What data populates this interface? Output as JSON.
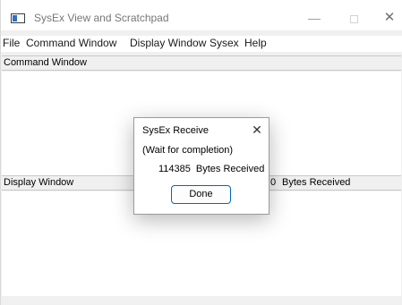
{
  "app": {
    "title": "SysEx View and Scratchpad",
    "window_controls": {
      "minimize": "—",
      "maximize": "",
      "close": "✕"
    }
  },
  "menu": {
    "items": [
      {
        "label": "File"
      },
      {
        "label": "Command Window"
      },
      {
        "label": "Display Window"
      },
      {
        "label": "Sysex"
      },
      {
        "label": "Help"
      }
    ]
  },
  "command_pane": {
    "label": "Command Window"
  },
  "display_pane": {
    "label": "Display Window",
    "bytes_count": "0",
    "bytes_label": "Bytes Received"
  },
  "dialog": {
    "title": "SysEx Receive",
    "close": "✕",
    "message": "(Wait for completion)",
    "bytes_count": "114385",
    "bytes_label": "Bytes Received",
    "done_label": "Done"
  }
}
